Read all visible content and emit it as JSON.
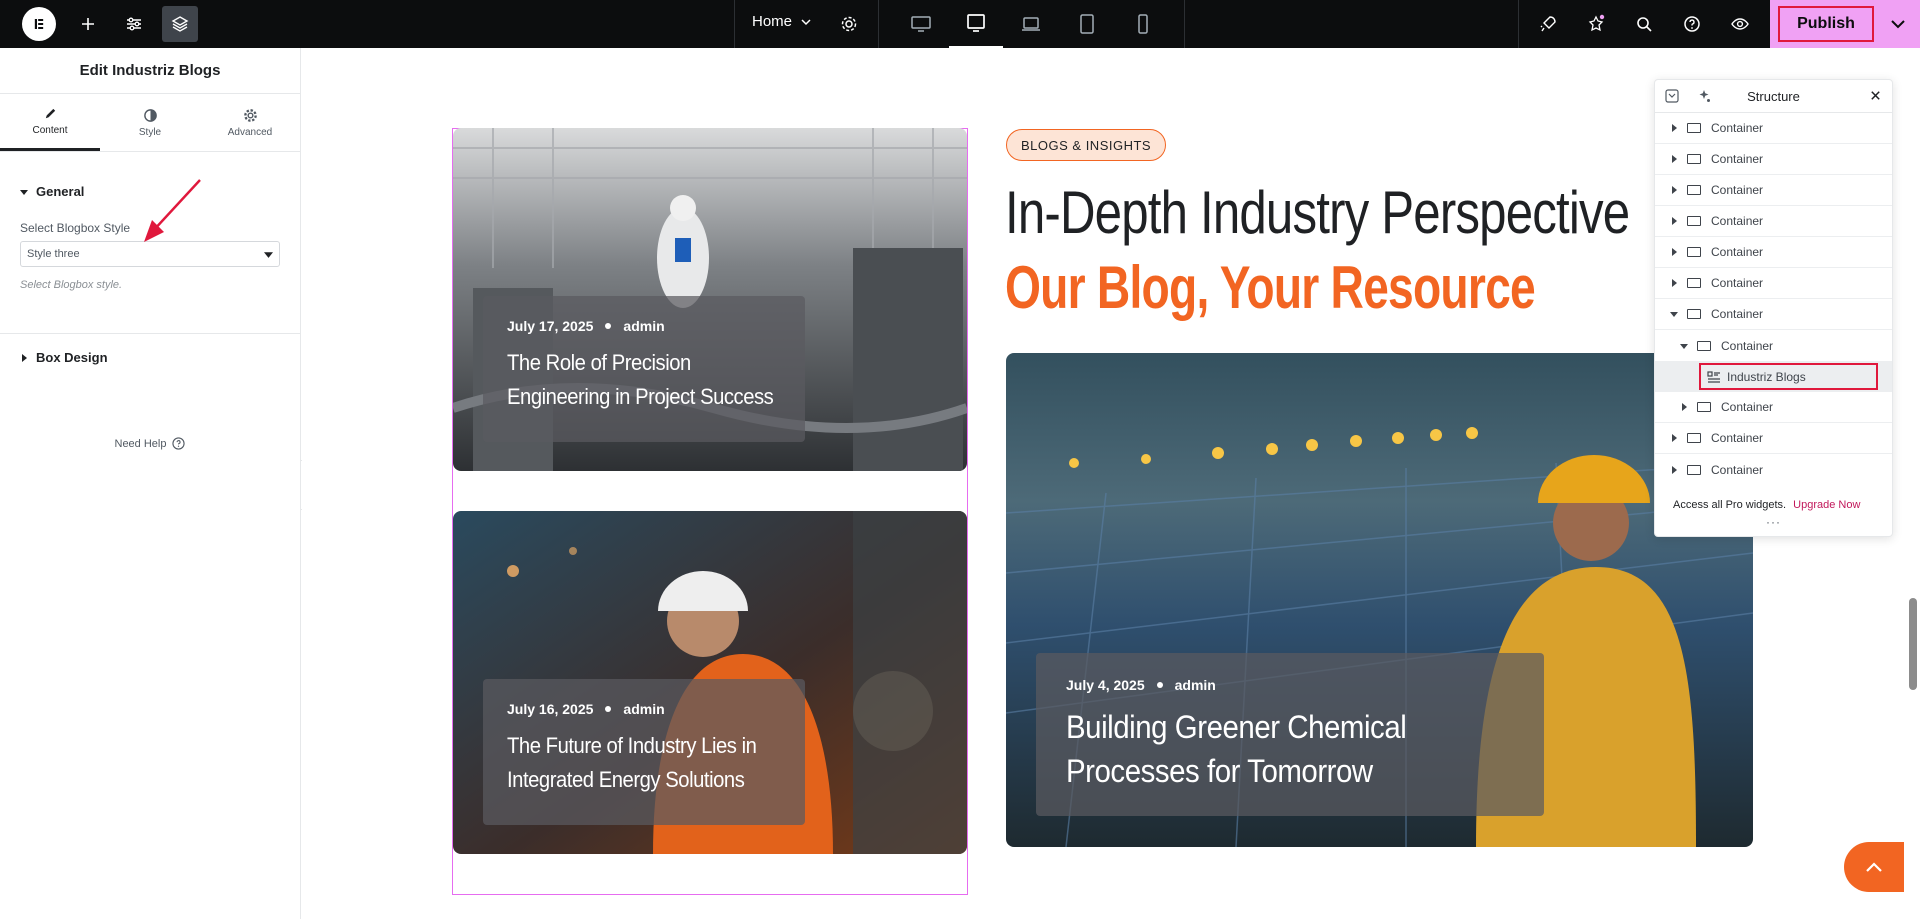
{
  "topbar": {
    "page_select": "Home",
    "publish_label": "Publish"
  },
  "panel": {
    "title": "Edit Industriz Blogs",
    "tabs": [
      {
        "label": "Content"
      },
      {
        "label": "Style"
      },
      {
        "label": "Advanced"
      }
    ],
    "general_section": "General",
    "select_label": "Select Blogbox Style",
    "select_value": "Style three",
    "select_desc": "Select Blogbox style.",
    "box_design_section": "Box Design",
    "need_help": "Need Help"
  },
  "canvas": {
    "badge": "BLOGS & INSIGHTS",
    "heading_line1": "In-Depth Industry Perspective",
    "heading_line2": "Our Blog, Your Resource",
    "posts": [
      {
        "date": "July 17, 2025",
        "author": "admin",
        "title": "The Role of Precision Engineering in Project Success"
      },
      {
        "date": "July 16, 2025",
        "author": "admin",
        "title": "The Future of Industry Lies in Integrated Energy Solutions"
      },
      {
        "date": "July 4, 2025",
        "author": "admin",
        "title": "Building Greener Chemical Processes for Tomorrow"
      }
    ]
  },
  "structure": {
    "title": "Structure",
    "items": [
      {
        "label": "Container"
      },
      {
        "label": "Container"
      },
      {
        "label": "Container"
      },
      {
        "label": "Container"
      },
      {
        "label": "Container"
      },
      {
        "label": "Container"
      },
      {
        "label": "Container"
      },
      {
        "label": "Container"
      },
      {
        "label": "Industriz Blogs"
      },
      {
        "label": "Container"
      },
      {
        "label": "Container"
      },
      {
        "label": "Container"
      }
    ],
    "footer_text": "Access all Pro widgets.",
    "footer_link": "Upgrade Now"
  },
  "colors": {
    "accent_orange": "#f26522",
    "publish_bg": "#f0a1f4",
    "highlight_red": "#e0183c",
    "selection_outline": "#e66cf0"
  }
}
